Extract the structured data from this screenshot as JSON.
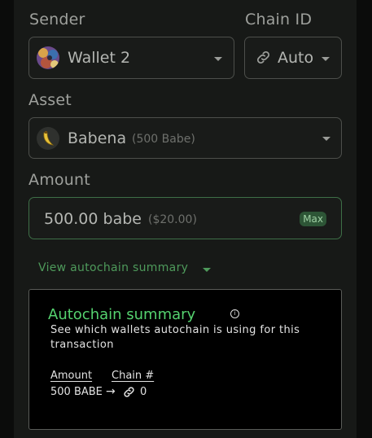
{
  "sender": {
    "label": "Sender",
    "value": "Wallet 2"
  },
  "chain": {
    "label": "Chain ID",
    "value": "Auto"
  },
  "asset": {
    "label": "Asset",
    "name": "Babena",
    "balance": "(500 Babe)"
  },
  "amount": {
    "label": "Amount",
    "value": "500.00 babe",
    "fiat": "($20.00)",
    "max_label": "Max"
  },
  "summary_toggle": {
    "label": "View autochain summary"
  },
  "summary": {
    "title": "Autochain summary",
    "info_glyph": "i",
    "description": "See which wallets autochain is using for this transaction",
    "columns": [
      "Amount",
      "Chain #"
    ],
    "rows": [
      {
        "amount": "500 BABE",
        "arrow": "→",
        "chain": "0"
      }
    ]
  },
  "colors": {
    "accent_green": "#55d26f",
    "toggle_green": "#4e9a5b",
    "border_active": "#3e6f47"
  },
  "icons": [
    "wallet-avatar-icon",
    "link-icon",
    "banana-icon",
    "chevron-down-icon",
    "info-icon"
  ]
}
